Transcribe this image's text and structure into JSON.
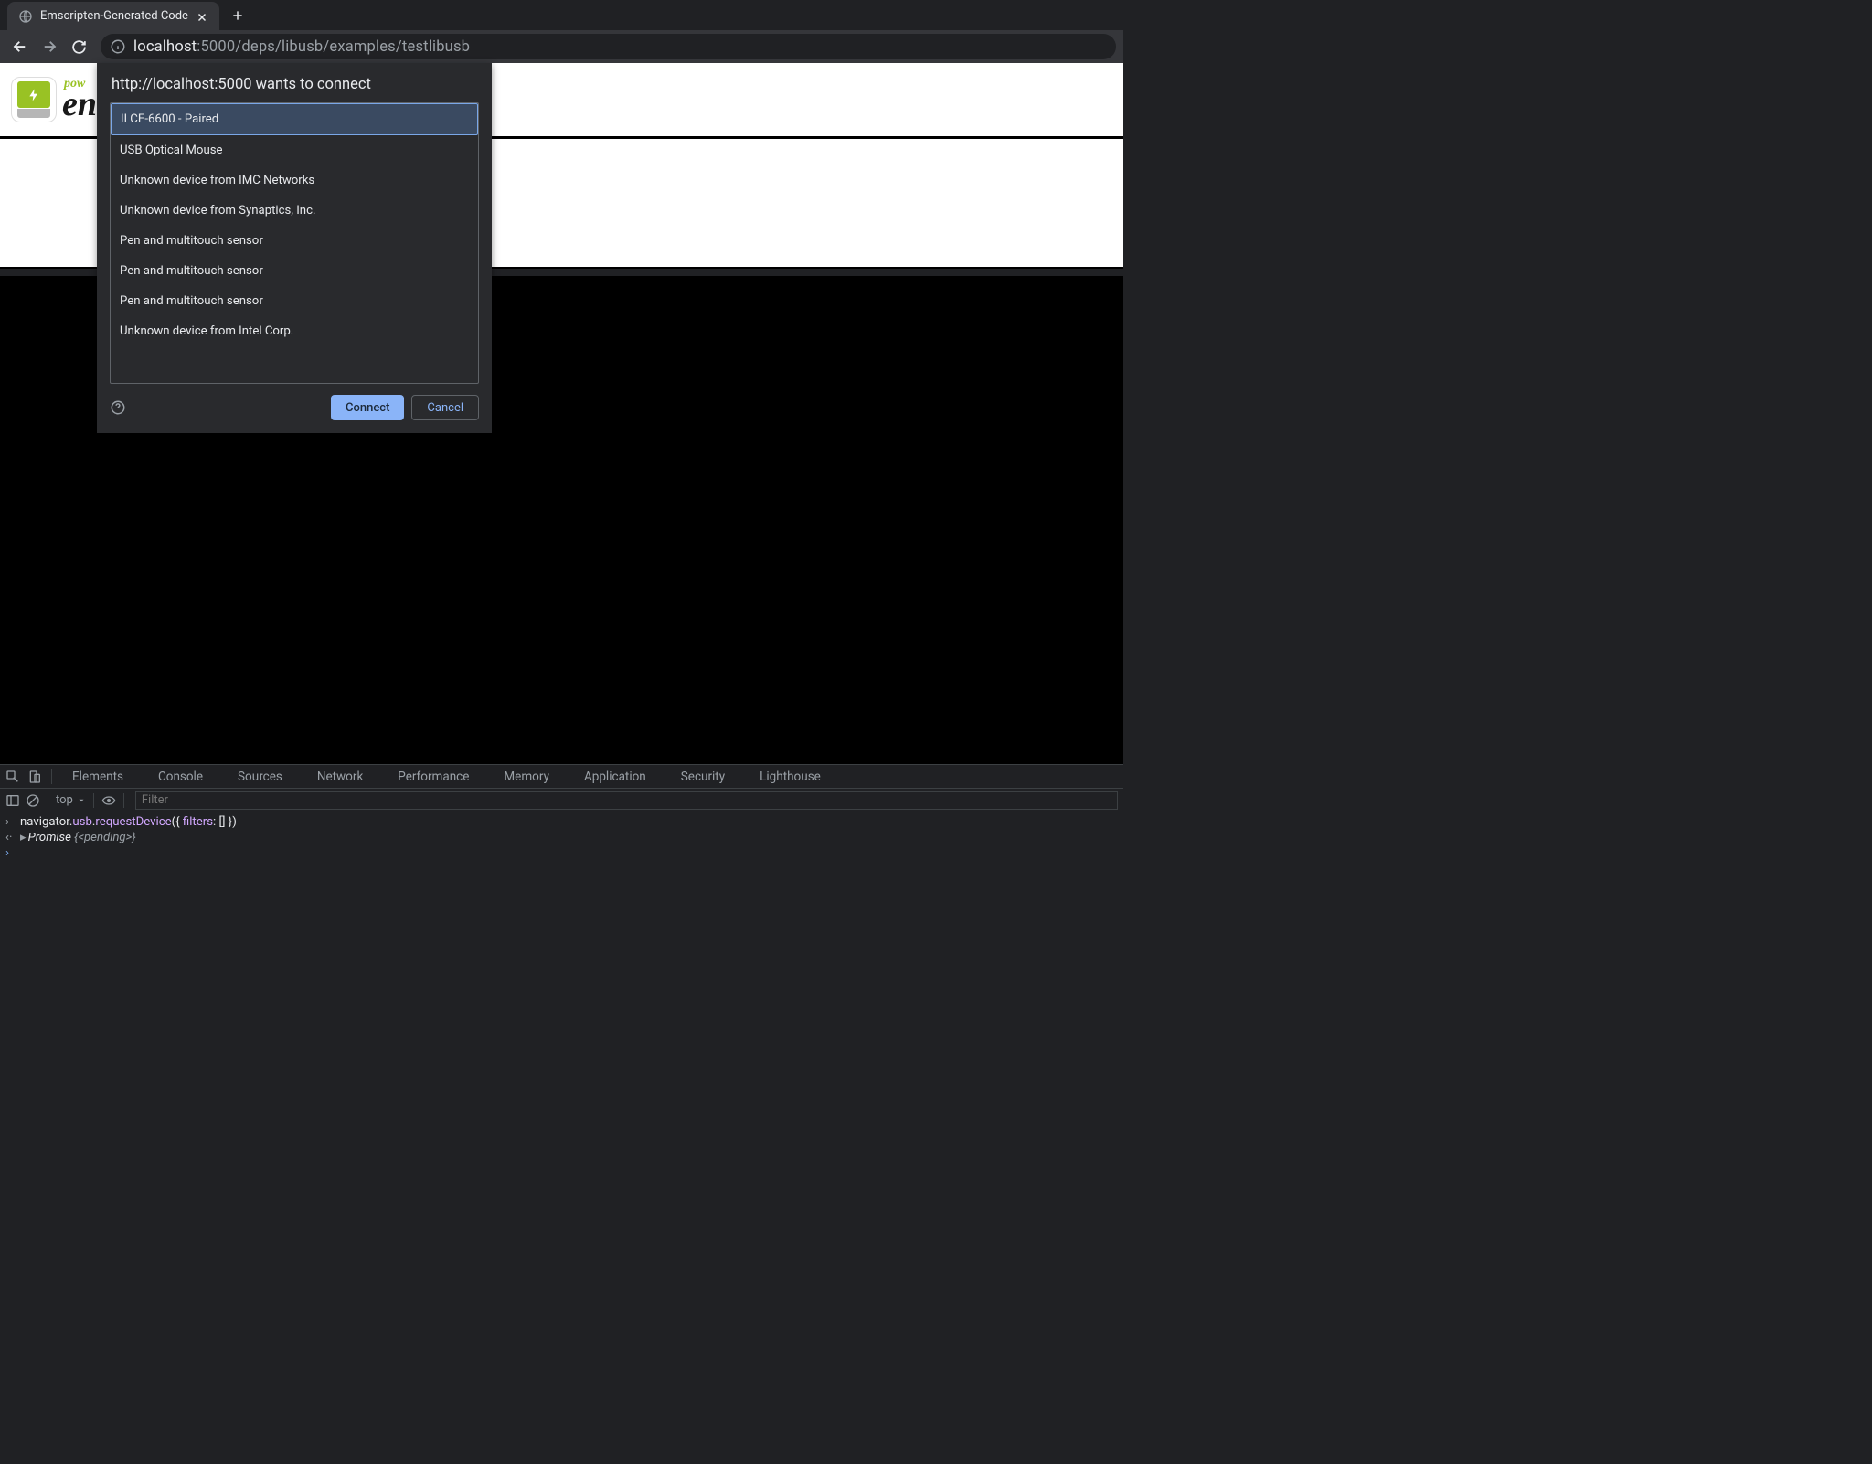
{
  "tab": {
    "title": "Emscripten-Generated Code"
  },
  "url": {
    "host": "localhost",
    "path": ":5000/deps/libusb/examples/testlibusb"
  },
  "page": {
    "logo_powered": "pow",
    "logo_em": "en"
  },
  "dialog": {
    "title": "http://localhost:5000 wants to connect",
    "devices": [
      "ILCE-6600 - Paired",
      "USB Optical Mouse",
      "Unknown device from IMC Networks",
      "Unknown device from Synaptics, Inc.",
      "Pen and multitouch sensor",
      "Pen and multitouch sensor",
      "Pen and multitouch sensor",
      "Unknown device from Intel Corp."
    ],
    "connect": "Connect",
    "cancel": "Cancel"
  },
  "devtools": {
    "tabs": [
      "Elements",
      "Console",
      "Sources",
      "Network",
      "Performance",
      "Memory",
      "Application",
      "Security",
      "Lighthouse"
    ],
    "context": "top",
    "filter_placeholder": "Filter",
    "console": {
      "input": "navigator.usb.requestDevice({ filters: [] })",
      "output_prefix": "Promise ",
      "output_state": "{<pending>}"
    }
  }
}
